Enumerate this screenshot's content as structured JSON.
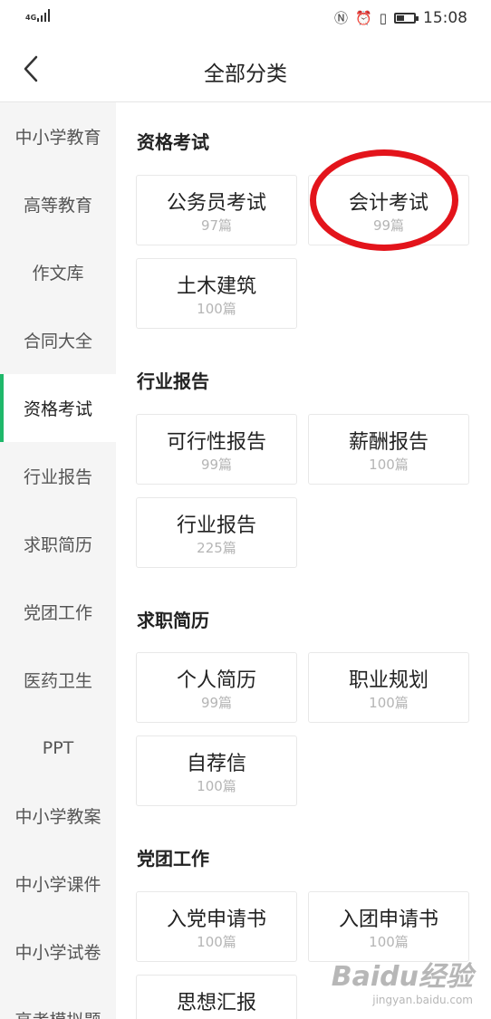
{
  "status_bar": {
    "network": "4G",
    "time": "15:08"
  },
  "header": {
    "title": "全部分类"
  },
  "sidebar": {
    "items": [
      {
        "label": "中小学教育"
      },
      {
        "label": "高等教育"
      },
      {
        "label": "作文库"
      },
      {
        "label": "合同大全"
      },
      {
        "label": "资格考试",
        "active": true
      },
      {
        "label": "行业报告"
      },
      {
        "label": "求职简历"
      },
      {
        "label": "党团工作"
      },
      {
        "label": "医药卫生"
      },
      {
        "label": "PPT"
      },
      {
        "label": "中小学教案"
      },
      {
        "label": "中小学课件"
      },
      {
        "label": "中小学试卷"
      },
      {
        "label": "高考模拟题"
      }
    ]
  },
  "sections": [
    {
      "title": "资格考试",
      "cards": [
        {
          "name": "公务员考试",
          "count": "97篇"
        },
        {
          "name": "会计考试",
          "count": "99篇"
        },
        {
          "name": "土木建筑",
          "count": "100篇"
        }
      ]
    },
    {
      "title": "行业报告",
      "cards": [
        {
          "name": "可行性报告",
          "count": "99篇"
        },
        {
          "name": "薪酬报告",
          "count": "100篇"
        },
        {
          "name": "行业报告",
          "count": "225篇"
        }
      ]
    },
    {
      "title": "求职简历",
      "cards": [
        {
          "name": "个人简历",
          "count": "99篇"
        },
        {
          "name": "职业规划",
          "count": "100篇"
        },
        {
          "name": "自荐信",
          "count": "100篇"
        }
      ]
    },
    {
      "title": "党团工作",
      "cards": [
        {
          "name": "入党申请书",
          "count": "100篇"
        },
        {
          "name": "入团申请书",
          "count": "100篇"
        },
        {
          "name": "思想汇报",
          "count": ""
        }
      ]
    }
  ],
  "annotation": {
    "highlight_color": "#e3141b",
    "highlighted_item": "会计考试"
  },
  "colors": {
    "accent": "#1fb86a",
    "sidebar_bg": "#f5f5f5",
    "count_text": "#b5b5b5"
  },
  "watermark": {
    "main": "Baidu经验",
    "sub": "jingyan.baidu.com"
  }
}
